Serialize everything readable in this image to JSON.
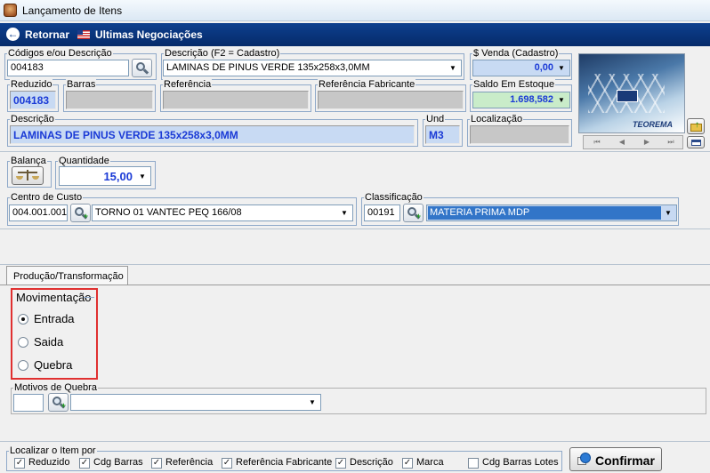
{
  "window": {
    "title": "Lançamento de Itens"
  },
  "toolbar": {
    "back_label": "Retornar",
    "history_label": "Ultimas Negociações"
  },
  "codigos": {
    "label": "Códigos e/ou Descrição",
    "value": "004183"
  },
  "descricao_cadastro": {
    "label": "Descrição (F2 = Cadastro)",
    "value": "LAMINAS DE PINUS VERDE 135x258x3,0MM"
  },
  "venda": {
    "label": "$ Venda (Cadastro)",
    "value": "0,00"
  },
  "reduzido": {
    "label": "Reduzido",
    "value": "004183"
  },
  "barras": {
    "label": "Barras",
    "value": ""
  },
  "referencia": {
    "label": "Referência",
    "value": ""
  },
  "referencia_fabricante": {
    "label": "Referência Fabricante",
    "value": ""
  },
  "saldo": {
    "label": "Saldo Em Estoque",
    "value": "1.698,582"
  },
  "descricao": {
    "label": "Descrição",
    "value": "LAMINAS DE PINUS VERDE 135x258x3,0MM"
  },
  "und": {
    "label": "Und",
    "value": "M3"
  },
  "localizacao": {
    "label": "Localização",
    "value": ""
  },
  "logo": {
    "text": "TEOREMA"
  },
  "nav": {
    "first": "⏮",
    "prev": "◀",
    "next": "▶",
    "last": "⏭"
  },
  "balanca": {
    "label": "Balança"
  },
  "quantidade": {
    "label": "Quantidade",
    "value": "15,00"
  },
  "centro_custo": {
    "label": "Centro de Custo",
    "code": "004.001.001",
    "value": "TORNO 01 VANTEC PEQ 166/08"
  },
  "classificacao": {
    "label": "Classificação",
    "code": "00191",
    "value": "MATERIA PRIMA MDP"
  },
  "tab": {
    "label": "Produção/Transformação"
  },
  "movimentacao": {
    "label": "Movimentação",
    "options": [
      {
        "label": "Entrada",
        "selected": true
      },
      {
        "label": "Saida",
        "selected": false
      },
      {
        "label": "Quebra",
        "selected": false
      }
    ]
  },
  "motivos": {
    "label": "Motivos de Quebra",
    "code": "",
    "value": ""
  },
  "localizar": {
    "label": "Localizar o Item por",
    "options": [
      {
        "label": "Reduzido",
        "checked": true
      },
      {
        "label": "Cdg Barras",
        "checked": true
      },
      {
        "label": "Referência",
        "checked": true
      },
      {
        "label": "Referência Fabricante",
        "checked": true
      },
      {
        "label": "Descrição",
        "checked": true
      },
      {
        "label": "Marca",
        "checked": true
      },
      {
        "label": "Cdg Barras Lotes",
        "checked": false
      }
    ]
  },
  "confirmar": {
    "label": "Confirmar"
  }
}
